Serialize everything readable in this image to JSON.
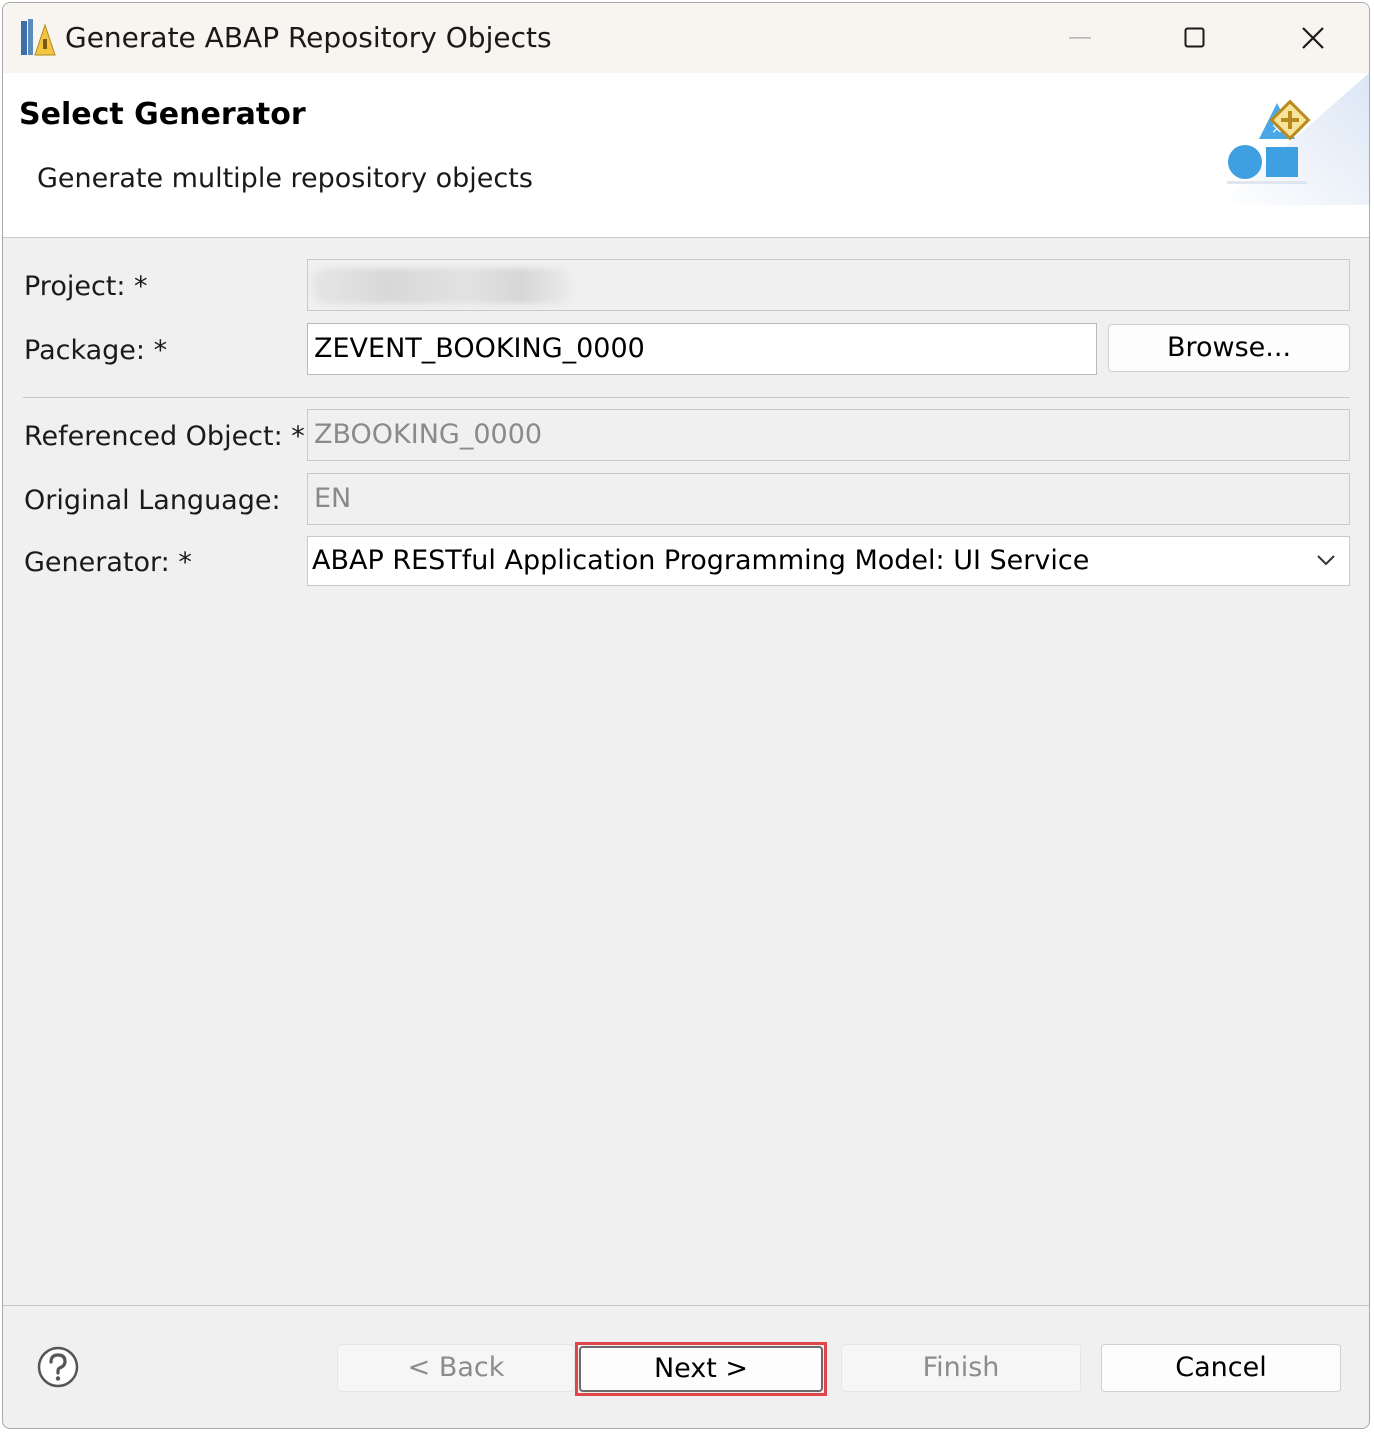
{
  "window": {
    "title": "Generate ABAP Repository Objects"
  },
  "banner": {
    "title": "Select Generator",
    "description": "Generate multiple repository objects"
  },
  "form": {
    "project_label": "Project: *",
    "project_value": "",
    "package_label": "Package: *",
    "package_value": "ZEVENT_BOOKING_0000",
    "browse_label": "Browse...",
    "referenced_object_label": "Referenced Object: *",
    "referenced_object_value": "ZBOOKING_0000",
    "original_language_label": "Original Language:",
    "original_language_value": "EN",
    "generator_label": "Generator: *",
    "generator_value": "ABAP RESTful Application Programming Model: UI Service"
  },
  "footer": {
    "back_label": "< Back",
    "next_label": "Next >",
    "finish_label": "Finish",
    "cancel_label": "Cancel"
  },
  "colors": {
    "highlight": "#e0454a",
    "accent_blue": "#3ea0e0",
    "accent_gold": "#c8962a"
  }
}
